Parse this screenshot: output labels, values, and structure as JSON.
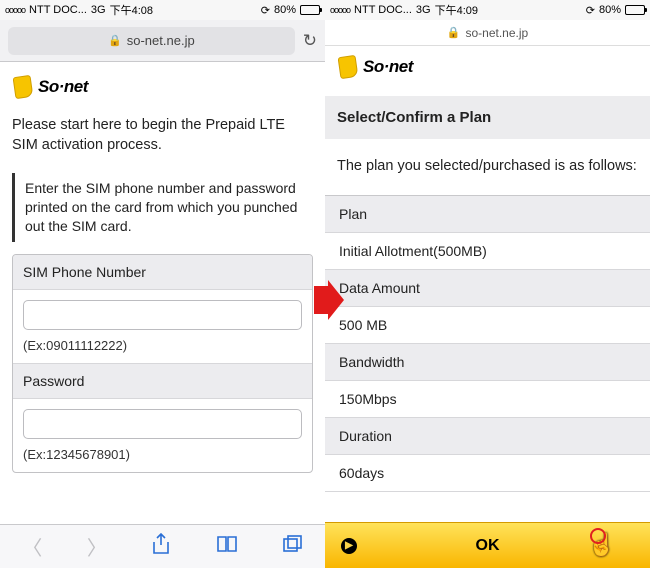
{
  "left": {
    "status": {
      "dots": "ooooo",
      "carrier": "NTT DOC...",
      "network": "3G",
      "time": "下午4:08",
      "batteryPct": "80%"
    },
    "url": "so-net.ne.jp",
    "brand": "So·net",
    "intro": "Please start here to begin the Prepaid LTE SIM activation process.",
    "note": "Enter the SIM phone number and password printed on the card from which you punched out the SIM card.",
    "simLabel": "SIM Phone Number",
    "simHint": "(Ex:09011112222)",
    "pwdLabel": "Password",
    "pwdHint": "(Ex:12345678901)"
  },
  "right": {
    "status": {
      "dots": "ooooo",
      "carrier": "NTT DOC...",
      "network": "3G",
      "time": "下午4:09",
      "batteryPct": "80%"
    },
    "url": "so-net.ne.jp",
    "brand": "So·net",
    "header": "Select/Confirm a Plan",
    "intro": "The plan you selected/purchased is as follows:",
    "rows": {
      "planH": "Plan",
      "planV": "Initial Allotment(500MB)",
      "dataH": "Data Amount",
      "dataV": "500 MB",
      "bwH": "Bandwidth",
      "bwV": "150Mbps",
      "durH": "Duration",
      "durV": "60days"
    },
    "ok": "OK"
  }
}
